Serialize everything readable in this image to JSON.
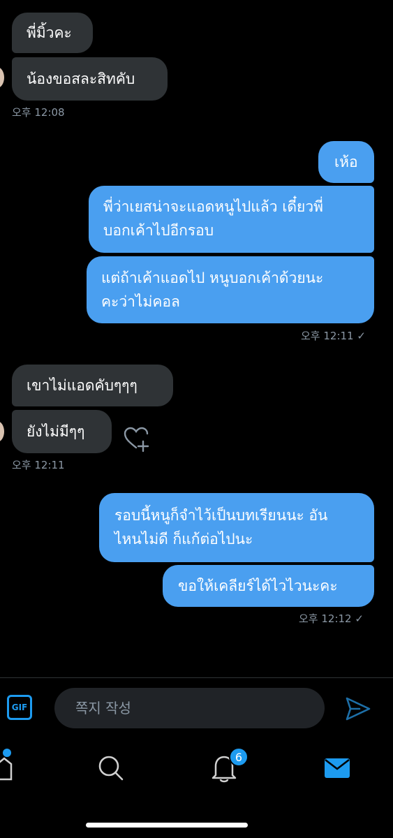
{
  "messages": [
    {
      "text": "พี่มิ้วคะ"
    },
    {
      "text": "น้องขอสละสิทคับ"
    },
    {
      "text": "เห้อ"
    },
    {
      "lines": [
        "พี่ว่าเยสน่าจะแอดหนูไปแล้ว เดี๋ยวพี่",
        "บอกเค้าไปอีกรอบ"
      ]
    },
    {
      "lines": [
        "แต่ถ้าเค้าแอดไป หนูบอกเค้าด้วยนะ",
        "คะว่าไม่คอล"
      ]
    },
    {
      "text": "เขาไม่แอดคับๆๆๆ"
    },
    {
      "text": "ยังไม่มีๆๆ"
    },
    {
      "lines": [
        "รอบนี้หนูก็จำไว้เป็นบทเรียนนะ อัน",
        "ไหนไม่ดี ก็แก้ต่อไปนะ"
      ]
    },
    {
      "text": "ขอให้เคลียร์ได้ไวไวนะคะ"
    }
  ],
  "timestamps": {
    "t1": "오후 12:08",
    "t2": "오후 12:11 ✓",
    "t3": "오후 12:11",
    "t4": "오후 12:12 ✓"
  },
  "composer": {
    "gif_label": "GIF",
    "placeholder": "쪽지 작성"
  },
  "nav": {
    "notifications_badge": "6"
  },
  "colors": {
    "sent_bubble": "#4a9ff0",
    "received_bubble": "#2f3336",
    "accent": "#1d9bf0"
  }
}
